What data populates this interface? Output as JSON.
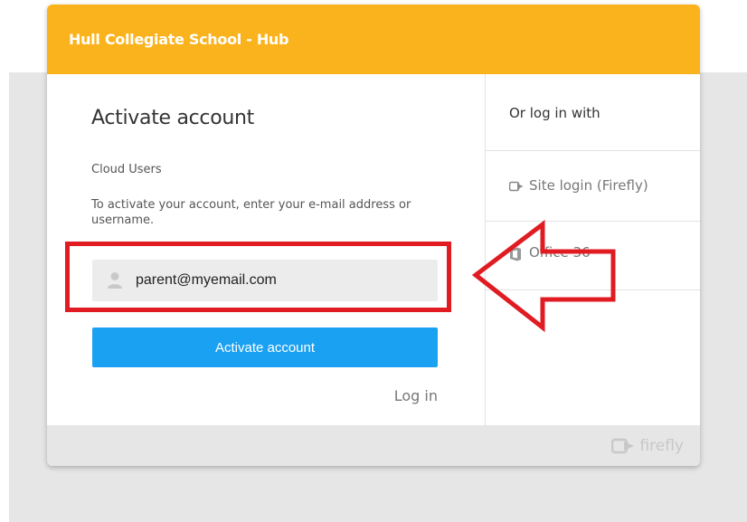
{
  "header": {
    "title": "Hull Collegiate School - Hub",
    "bg_color": "#fbb31d"
  },
  "activate": {
    "heading": "Activate account",
    "section_label": "Cloud Users",
    "instructions": "To activate your account, enter your e-mail address or username.",
    "email_value": "parent@myemail.com",
    "user_icon": "user-icon",
    "button_label": "Activate account",
    "button_color": "#1ba1f2",
    "login_link": "Log in"
  },
  "alt_login": {
    "heading": "Or log in with",
    "options": [
      {
        "label": "Site login (Firefly)",
        "icon": "firefly-icon"
      },
      {
        "label": "Office 36",
        "icon": "office-icon"
      }
    ]
  },
  "footer": {
    "brand": "firefly",
    "icon": "firefly-logo-icon"
  },
  "annotation": {
    "color": "#e01b22"
  }
}
